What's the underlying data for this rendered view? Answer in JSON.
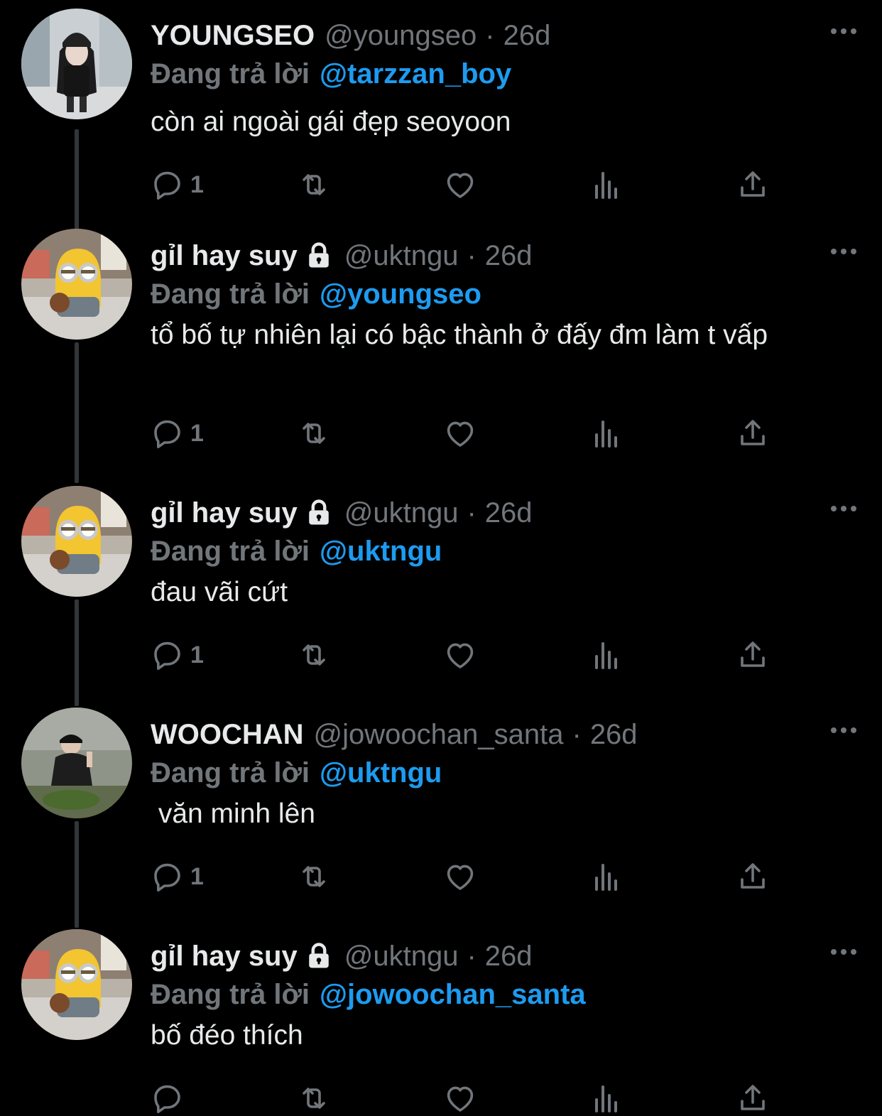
{
  "colors": {
    "background": "#000000",
    "primary_text": "#e7e9ea",
    "secondary_text": "#71767b",
    "accent_link": "#1d9bf0",
    "thread_line": "#333639"
  },
  "icons": {
    "reply": "reply-icon",
    "retweet": "retweet-icon",
    "like": "like-icon",
    "views": "views-icon",
    "share": "share-icon",
    "more": "more-icon",
    "lock": "lock-icon"
  },
  "tweets": [
    {
      "display_name": "YOUNGSEO",
      "handle": "@youngseo",
      "separator": "·",
      "time": "26d",
      "protected": false,
      "reply_prefix": "Đang trả lời",
      "reply_to": "@tarzzan_boy",
      "text": "còn ai ngoài gái đẹp seoyoon",
      "reply_count": "1"
    },
    {
      "display_name": "gỉl hay suy",
      "handle": "@uktngu",
      "separator": "·",
      "time": "26d",
      "protected": true,
      "reply_prefix": "Đang trả lời",
      "reply_to": "@youngseo",
      "text": "tổ bố tự nhiên lại có bậc thành ở đấy đm làm t vấp",
      "reply_count": "1"
    },
    {
      "display_name": "gỉl hay suy",
      "handle": "@uktngu",
      "separator": "·",
      "time": "26d",
      "protected": true,
      "reply_prefix": "Đang trả lời",
      "reply_to": "@uktngu",
      "text": "đau vãi cứt",
      "reply_count": "1"
    },
    {
      "display_name": "WOOCHAN",
      "handle": "@jowoochan_santa",
      "separator": "·",
      "time": "26d",
      "protected": false,
      "reply_prefix": "Đang trả lời",
      "reply_to": "@uktngu",
      "text": " văn minh lên",
      "reply_count": "1"
    },
    {
      "display_name": "gỉl hay suy",
      "handle": "@uktngu",
      "separator": "·",
      "time": "26d",
      "protected": true,
      "reply_prefix": "Đang trả lời",
      "reply_to": "@jowoochan_santa",
      "text": "bố đéo thích",
      "reply_count": ""
    }
  ]
}
